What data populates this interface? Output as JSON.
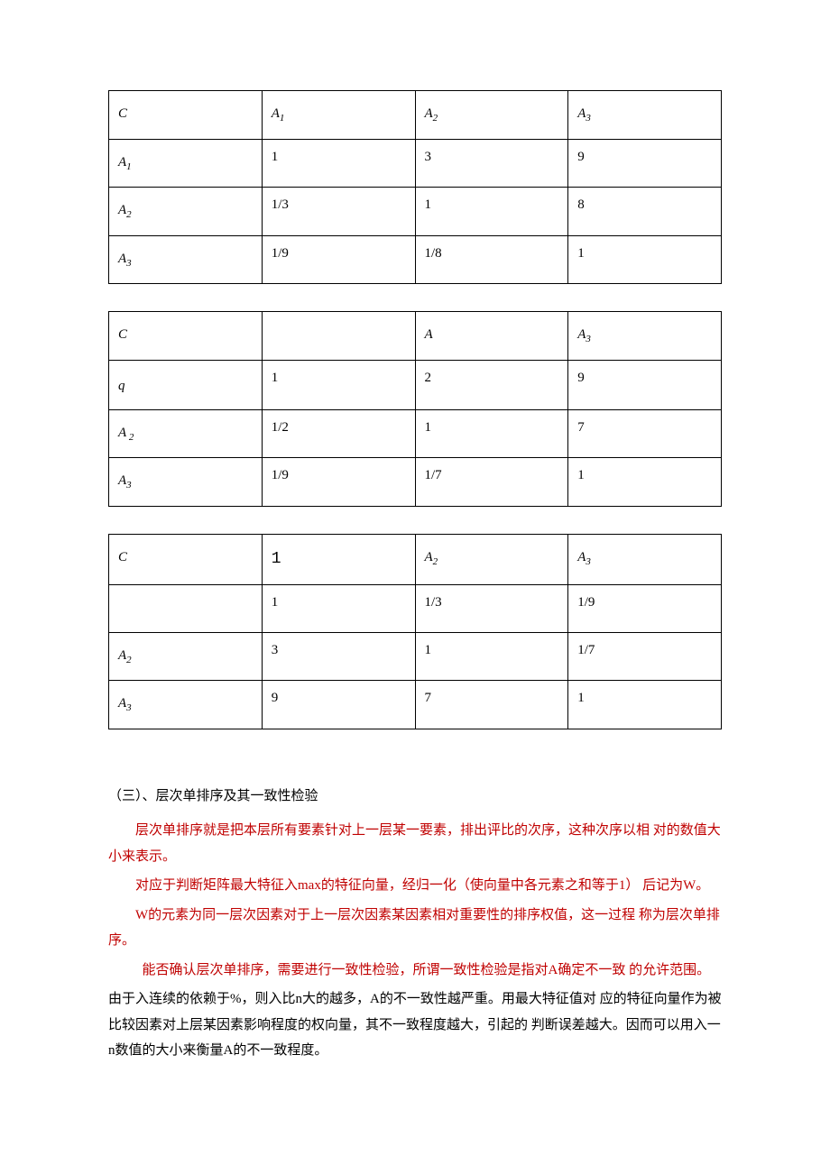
{
  "table1": {
    "header": {
      "c0": "C",
      "c1_base": "A",
      "c1_sub": "1",
      "c2_base": "A",
      "c2_sub": "2",
      "c3_base": "A",
      "c3_sub": "3"
    },
    "rows": [
      {
        "label_base": "A",
        "label_sub": "1",
        "v1": "1",
        "v2": "3",
        "v3": "9"
      },
      {
        "label_base": "A",
        "label_sub": "2",
        "v1": "1/3",
        "v2": "1",
        "v3": "8"
      },
      {
        "label_base": "A",
        "label_sub": "3",
        "v1": "1/9",
        "v2": "1/8",
        "v3": "1"
      }
    ]
  },
  "table2": {
    "header": {
      "c0": "C",
      "c1": "",
      "c2_base": "A",
      "c2_sub": "",
      "c3_base": "A",
      "c3_sub": "3"
    },
    "rows": [
      {
        "label": "q",
        "v1": "1",
        "v2": "2",
        "v3": "9"
      },
      {
        "label_base": "A",
        "label_sub": " 2",
        "v1": "1/2",
        "v2": "1",
        "v3": "7"
      },
      {
        "label_base": "A",
        "label_sub": "3",
        "v1": "1/9",
        "v2": "1/7",
        "v3": "1"
      }
    ]
  },
  "table3": {
    "header": {
      "c0": "C",
      "c1": "1",
      "c2_base": "A",
      "c2_sub": "2",
      "c3_base": "A",
      "c3_sub": "3"
    },
    "rows": [
      {
        "label": "",
        "v1": "1",
        "v2": "1/3",
        "v3": "1/9"
      },
      {
        "label_base": "A",
        "label_sub": "2",
        "v1": "3",
        "v2": "1",
        "v3": "1/7"
      },
      {
        "label_base": "A",
        "label_sub": "3",
        "v1": "9",
        "v2": "7",
        "v3": "1"
      }
    ]
  },
  "section_title": "（三）、层次单排序及其一致性检验",
  "para1": "层次单排序就是把本层所有要素针对上一层某一要素，排出评比的次序，这种次序以相 对的数值大小来表示。",
  "para2": "对应于判断矩阵最大特征入max的特征向量，经归一化（使向量中各元素之和等于1） 后记为W。",
  "para3": "W的元素为同一层次因素对于上一层次因素某因素相对重要性的排序权值，这一过程 称为层次单排序。",
  "para4": " 能否确认层次单排序，需要进行一致性检验，所谓一致性检验是指对A确定不一致 的允许范围。",
  "para5": "由于入连续的依赖于%，则入比n大的越多，A的不一致性越严重。用最大特征值对 应的特征向量作为被比较因素对上层某因素影响程度的权向量，其不一致程度越大，引起的 判断误差越大。因而可以用入一n数值的大小来衡量A的不一致程度。"
}
